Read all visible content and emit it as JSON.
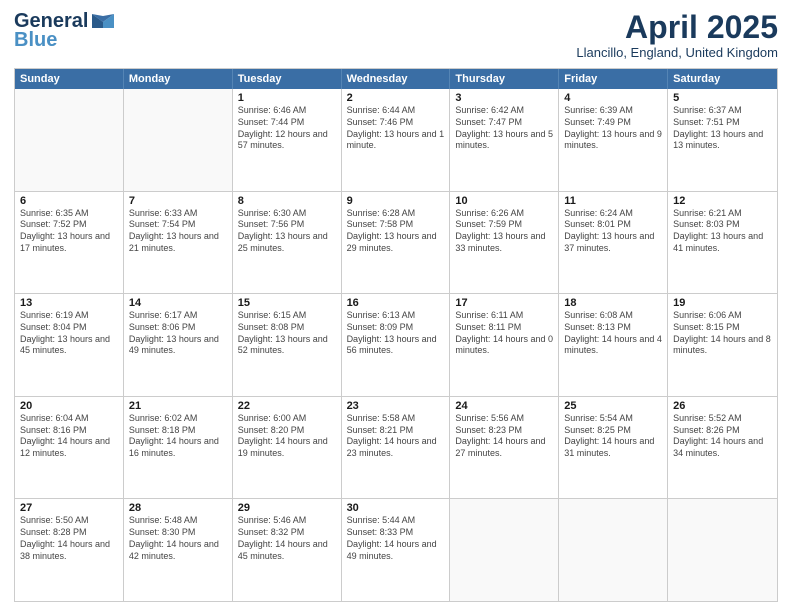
{
  "header": {
    "logo_line1": "General",
    "logo_line2": "Blue",
    "month_title": "April 2025",
    "location": "Llancillo, England, United Kingdom"
  },
  "days_of_week": [
    "Sunday",
    "Monday",
    "Tuesday",
    "Wednesday",
    "Thursday",
    "Friday",
    "Saturday"
  ],
  "weeks": [
    [
      {
        "day": "",
        "info": ""
      },
      {
        "day": "",
        "info": ""
      },
      {
        "day": "1",
        "info": "Sunrise: 6:46 AM\nSunset: 7:44 PM\nDaylight: 12 hours and 57 minutes."
      },
      {
        "day": "2",
        "info": "Sunrise: 6:44 AM\nSunset: 7:46 PM\nDaylight: 13 hours and 1 minute."
      },
      {
        "day": "3",
        "info": "Sunrise: 6:42 AM\nSunset: 7:47 PM\nDaylight: 13 hours and 5 minutes."
      },
      {
        "day": "4",
        "info": "Sunrise: 6:39 AM\nSunset: 7:49 PM\nDaylight: 13 hours and 9 minutes."
      },
      {
        "day": "5",
        "info": "Sunrise: 6:37 AM\nSunset: 7:51 PM\nDaylight: 13 hours and 13 minutes."
      }
    ],
    [
      {
        "day": "6",
        "info": "Sunrise: 6:35 AM\nSunset: 7:52 PM\nDaylight: 13 hours and 17 minutes."
      },
      {
        "day": "7",
        "info": "Sunrise: 6:33 AM\nSunset: 7:54 PM\nDaylight: 13 hours and 21 minutes."
      },
      {
        "day": "8",
        "info": "Sunrise: 6:30 AM\nSunset: 7:56 PM\nDaylight: 13 hours and 25 minutes."
      },
      {
        "day": "9",
        "info": "Sunrise: 6:28 AM\nSunset: 7:58 PM\nDaylight: 13 hours and 29 minutes."
      },
      {
        "day": "10",
        "info": "Sunrise: 6:26 AM\nSunset: 7:59 PM\nDaylight: 13 hours and 33 minutes."
      },
      {
        "day": "11",
        "info": "Sunrise: 6:24 AM\nSunset: 8:01 PM\nDaylight: 13 hours and 37 minutes."
      },
      {
        "day": "12",
        "info": "Sunrise: 6:21 AM\nSunset: 8:03 PM\nDaylight: 13 hours and 41 minutes."
      }
    ],
    [
      {
        "day": "13",
        "info": "Sunrise: 6:19 AM\nSunset: 8:04 PM\nDaylight: 13 hours and 45 minutes."
      },
      {
        "day": "14",
        "info": "Sunrise: 6:17 AM\nSunset: 8:06 PM\nDaylight: 13 hours and 49 minutes."
      },
      {
        "day": "15",
        "info": "Sunrise: 6:15 AM\nSunset: 8:08 PM\nDaylight: 13 hours and 52 minutes."
      },
      {
        "day": "16",
        "info": "Sunrise: 6:13 AM\nSunset: 8:09 PM\nDaylight: 13 hours and 56 minutes."
      },
      {
        "day": "17",
        "info": "Sunrise: 6:11 AM\nSunset: 8:11 PM\nDaylight: 14 hours and 0 minutes."
      },
      {
        "day": "18",
        "info": "Sunrise: 6:08 AM\nSunset: 8:13 PM\nDaylight: 14 hours and 4 minutes."
      },
      {
        "day": "19",
        "info": "Sunrise: 6:06 AM\nSunset: 8:15 PM\nDaylight: 14 hours and 8 minutes."
      }
    ],
    [
      {
        "day": "20",
        "info": "Sunrise: 6:04 AM\nSunset: 8:16 PM\nDaylight: 14 hours and 12 minutes."
      },
      {
        "day": "21",
        "info": "Sunrise: 6:02 AM\nSunset: 8:18 PM\nDaylight: 14 hours and 16 minutes."
      },
      {
        "day": "22",
        "info": "Sunrise: 6:00 AM\nSunset: 8:20 PM\nDaylight: 14 hours and 19 minutes."
      },
      {
        "day": "23",
        "info": "Sunrise: 5:58 AM\nSunset: 8:21 PM\nDaylight: 14 hours and 23 minutes."
      },
      {
        "day": "24",
        "info": "Sunrise: 5:56 AM\nSunset: 8:23 PM\nDaylight: 14 hours and 27 minutes."
      },
      {
        "day": "25",
        "info": "Sunrise: 5:54 AM\nSunset: 8:25 PM\nDaylight: 14 hours and 31 minutes."
      },
      {
        "day": "26",
        "info": "Sunrise: 5:52 AM\nSunset: 8:26 PM\nDaylight: 14 hours and 34 minutes."
      }
    ],
    [
      {
        "day": "27",
        "info": "Sunrise: 5:50 AM\nSunset: 8:28 PM\nDaylight: 14 hours and 38 minutes."
      },
      {
        "day": "28",
        "info": "Sunrise: 5:48 AM\nSunset: 8:30 PM\nDaylight: 14 hours and 42 minutes."
      },
      {
        "day": "29",
        "info": "Sunrise: 5:46 AM\nSunset: 8:32 PM\nDaylight: 14 hours and 45 minutes."
      },
      {
        "day": "30",
        "info": "Sunrise: 5:44 AM\nSunset: 8:33 PM\nDaylight: 14 hours and 49 minutes."
      },
      {
        "day": "",
        "info": ""
      },
      {
        "day": "",
        "info": ""
      },
      {
        "day": "",
        "info": ""
      }
    ]
  ]
}
